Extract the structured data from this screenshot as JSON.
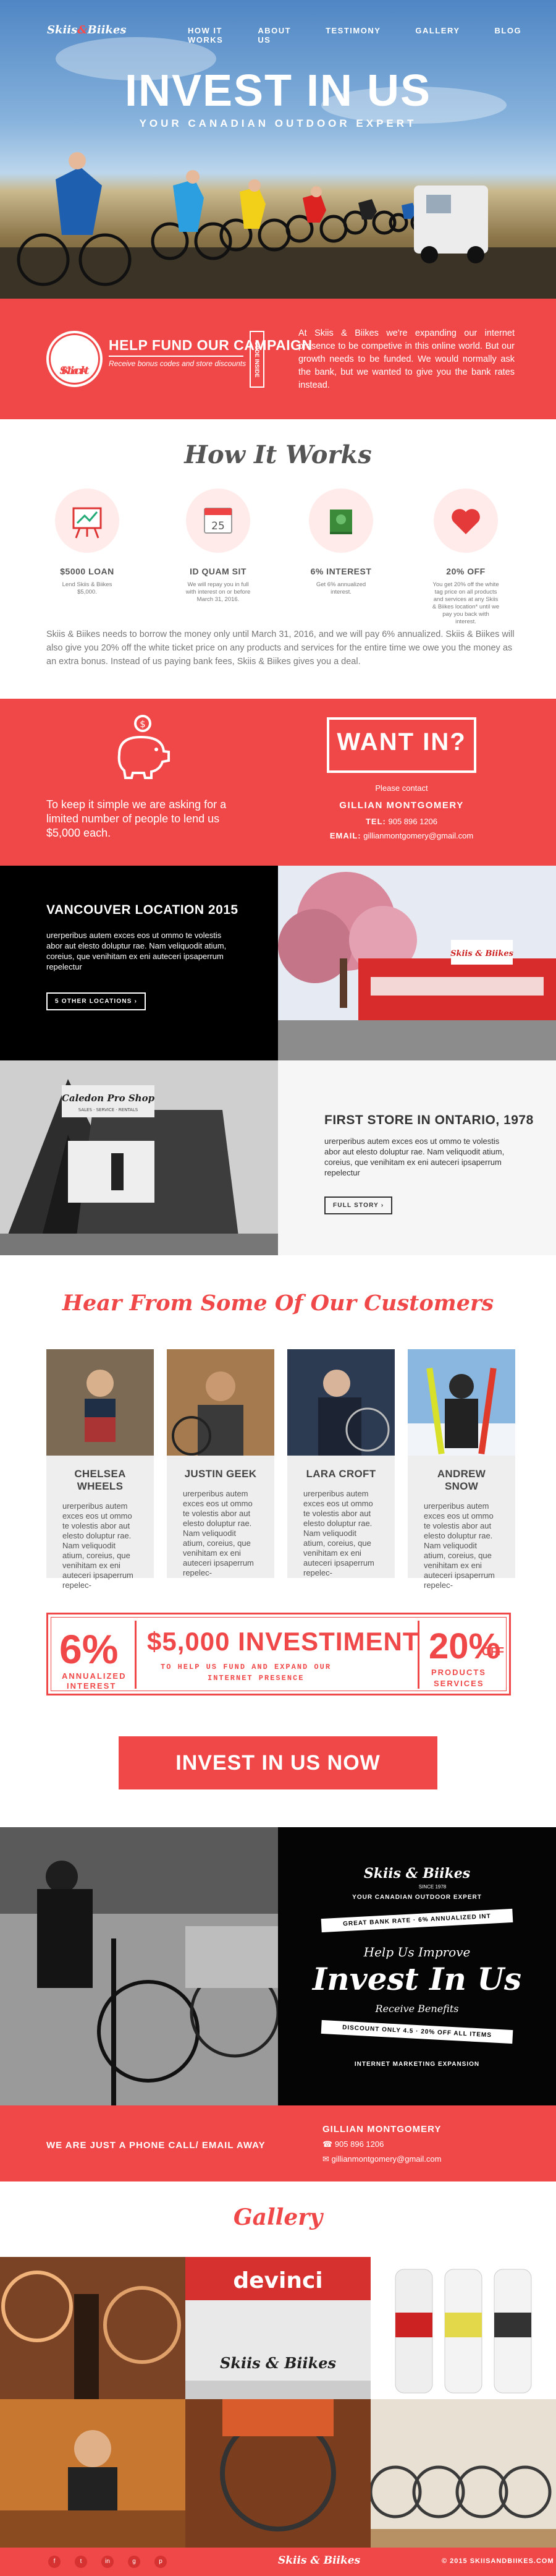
{
  "brand": {
    "logo_part1": "Skiis",
    "logo_amp": "&",
    "logo_part2": "Biikes",
    "accent": "#f04848"
  },
  "nav": {
    "items": [
      "HOW IT WORKS",
      "ABOUT US",
      "TESTIMONY",
      "GALLERY",
      "BLOG"
    ]
  },
  "hero": {
    "title": "INVEST IN US",
    "subtitle": "YOUR CANADIAN OUTDOOR EXPERT"
  },
  "kickstart": {
    "badge_line1": "Kick",
    "badge_line2": "Start",
    "heading": "HELP FUND OUR CAMPAIGN",
    "subheading": "Receive bonus codes and store discounts",
    "code_label": "CODE INSIDE",
    "text": "At Skiis & Biikes we're expanding our internet presence to be competive in this online world. But our growth needs to be funded. We would normally ask the bank, but we wanted to give you the bank rates instead."
  },
  "how": {
    "title": "How It Works",
    "steps": [
      {
        "icon": "easel-icon",
        "label": "$5000 LOAN",
        "text": "Lend Skiis & Biikes $5,000."
      },
      {
        "icon": "calendar-icon",
        "label": "ID QUAM SIT",
        "text": "We will repay you in full with interest on or before March 31, 2016."
      },
      {
        "icon": "money-icon",
        "label": "6% INTEREST",
        "text": "Get 6% annualized interest."
      },
      {
        "icon": "heart-icon",
        "label": "20% OFF",
        "text": "You get 20% off the white tag price on all products and services at any Skiis & Biikes location* until we pay you back with interest."
      }
    ],
    "calendar_day": "25",
    "paragraph": "Skiis & Biikes needs to borrow the money only until March 31, 2016, and we will pay 6% annualized. Skiis & Biikes will also give you 20% off the white ticket price on any products and services for the entire time we owe you the money as an extra bonus. Instead of us paying bank fees, Skiis & Biikes gives you a deal."
  },
  "want": {
    "left_text": "To keep it simple we are asking for a limited number of people to lend us $5,000 each.",
    "box": "WANT IN?",
    "please_contact": "Please contact",
    "name": "GILLIAN MONTGOMERY",
    "tel_label": "TEL:",
    "tel": "905 896 1206",
    "email_label": "EMAIL:",
    "email": "gillianmontgomery@gmail.com"
  },
  "locations": {
    "vancouver": {
      "title": "VANCOUVER LOCATION 2015",
      "text": "urerperibus autem exces eos ut ommo te volestis abor aut elesto doluptur rae. Nam veliquodit atium, coreius, que venihitam ex eni auteceri ipsaperrum repelectur",
      "button": "5 OTHER LOCATIONS"
    },
    "ontario": {
      "title": "FIRST STORE IN ONTARIO, 1978",
      "text": "urerperibus autem exces eos ut ommo te volestis abor aut elesto doluptur rae. Nam veliquodit atium, coreius, que venihitam ex eni auteceri ipsaperrum repelectur",
      "button": "FULL STORY"
    },
    "store_sign_1": "Caledon Pro Shop",
    "store_sign_2": "SALES · SERVICE · RENTALS",
    "store_sign_3": "Skiis & Biikes"
  },
  "customers": {
    "title": "Hear From Some Of Our Customers",
    "cards": [
      {
        "name": "CHELSEA WHEELS",
        "text": "urerperibus autem exces eos ut ommo te volestis abor aut elesto doluptur rae. Nam veliquodit atium, coreius, que venihitam ex eni auteceri ipsaperrum repelec-"
      },
      {
        "name": "JUSTIN GEEK",
        "text": "urerperibus autem exces eos ut ommo te volestis abor aut elesto doluptur rae. Nam veliquodit atium, coreius, que venihitam ex eni auteceri ipsaperrum repelec-"
      },
      {
        "name": "LARA CROFT",
        "text": "urerperibus autem exces eos ut ommo te volestis abor aut elesto doluptur rae. Nam veliquodit atium, coreius, que venihitam ex eni auteceri ipsaperrum repelec-"
      },
      {
        "name": "ANDREW SNOW",
        "text": "urerperibus autem exces eos ut ommo te volestis abor aut elesto doluptur rae. Nam veliquodit atium, coreius, que venihitam ex eni auteceri ipsaperrum repelec-"
      }
    ]
  },
  "stats": {
    "left_big": "6%",
    "left_small1": "ANNUALIZED",
    "left_small2": "INTEREST",
    "mid_big": "$5,000 INVESTIMENT",
    "mid_small1": "TO HELP US FUND AND EXPAND OUR",
    "mid_small2": "INTERNET PRESENCE",
    "right_big": "20%",
    "right_off": "OFF",
    "right_small1": "PRODUCTS",
    "right_small2": "SERVICES"
  },
  "cta": {
    "label": "INVEST IN US NOW"
  },
  "poster": {
    "logo": "Skiis & Biikes",
    "since": "SINCE 1978",
    "tagline": "YOUR CANADIAN OUTDOOR EXPERT",
    "band1": "GREAT BANK RATE · 6% ANNUALIZED INT",
    "help": "Help Us Improve",
    "big": "Invest In Us",
    "receive": "Receive Benefits",
    "band2": "DISCOUNT ONLY 4.5 · 20% OFF ALL ITEMS",
    "bottom": "INTERNET MARKETING EXPANSION"
  },
  "phone": {
    "left": "WE ARE JUST A PHONE CALL/ EMAIL AWAY",
    "name": "GILLIAN MONTGOMERY",
    "tel": "905 896 1206",
    "email": "gillianmontgomery@gmail.com"
  },
  "gallery": {
    "title": "Gallery",
    "banner": "devinci",
    "shop_sign": "Skiis & Biikes"
  },
  "footer": {
    "socials": [
      "f",
      "t",
      "in",
      "g",
      "p"
    ],
    "logo": "Skiis & Biikes",
    "copyright": "© 2015  SKIISANDBIIKES.COM"
  }
}
